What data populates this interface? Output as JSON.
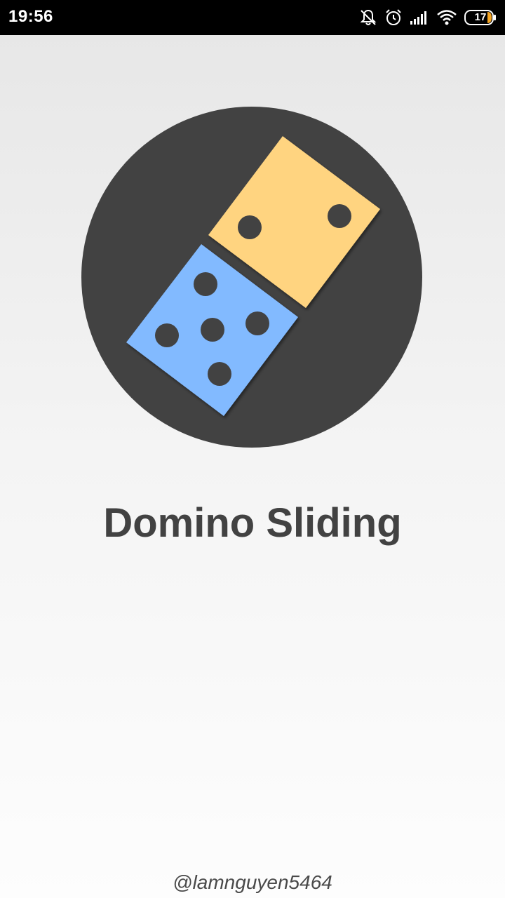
{
  "status_bar": {
    "time": "19:56",
    "battery_level": "17",
    "icons": [
      "notifications-off-icon",
      "alarm-icon",
      "signal-icon",
      "wifi-icon",
      "battery-icon"
    ]
  },
  "app": {
    "title": "Domino Sliding",
    "author": "@lamnguyen5464"
  },
  "logo": {
    "icon": "domino-logo-icon",
    "circle_color": "#424242",
    "top_tile_color": "#FFD480",
    "bottom_tile_color": "#82BAFF",
    "pip_color": "#424242",
    "top_tile_pips": 2,
    "bottom_tile_pips": 5
  }
}
